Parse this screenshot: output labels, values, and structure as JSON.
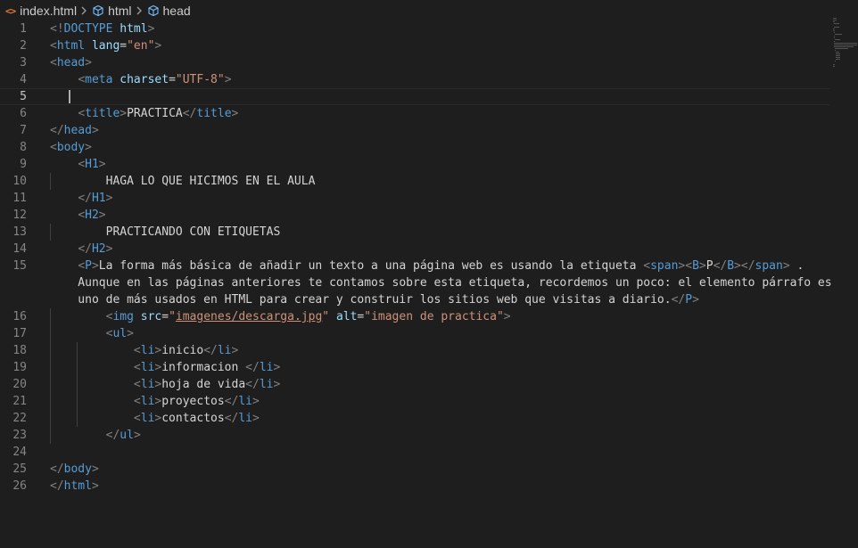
{
  "breadcrumb": {
    "file": "index.html",
    "items": [
      "html",
      "head"
    ]
  },
  "editor": {
    "current_line": 5,
    "lines": [
      {
        "n": "1",
        "tokens": [
          [
            "t",
            "<!"
          ],
          [
            "tn",
            "DOCTYPE"
          ],
          [
            "tx",
            " "
          ],
          [
            "an",
            "html"
          ],
          [
            "t",
            ">"
          ]
        ]
      },
      {
        "n": "2",
        "tokens": [
          [
            "t",
            "<"
          ],
          [
            "tn",
            "html"
          ],
          [
            "tx",
            " "
          ],
          [
            "an",
            "lang"
          ],
          [
            "tx",
            "="
          ],
          [
            "av",
            "\"en\""
          ],
          [
            "t",
            ">"
          ]
        ]
      },
      {
        "n": "3",
        "tokens": [
          [
            "t",
            "<"
          ],
          [
            "tn",
            "head"
          ],
          [
            "t",
            ">"
          ]
        ]
      },
      {
        "n": "4",
        "tokens": [
          [
            "tx",
            "    "
          ],
          [
            "t",
            "<"
          ],
          [
            "tn",
            "meta"
          ],
          [
            "tx",
            " "
          ],
          [
            "an",
            "charset"
          ],
          [
            "tx",
            "="
          ],
          [
            "av",
            "\"UTF-8\""
          ],
          [
            "t",
            ">"
          ]
        ]
      },
      {
        "n": "5",
        "tokens": []
      },
      {
        "n": "6",
        "tokens": [
          [
            "tx",
            "    "
          ],
          [
            "t",
            "<"
          ],
          [
            "tn",
            "title"
          ],
          [
            "t",
            ">"
          ],
          [
            "tx",
            "PRACTICA"
          ],
          [
            "t",
            "</"
          ],
          [
            "tn",
            "title"
          ],
          [
            "t",
            ">"
          ]
        ]
      },
      {
        "n": "7",
        "tokens": [
          [
            "t",
            "</"
          ],
          [
            "tn",
            "head"
          ],
          [
            "t",
            ">"
          ]
        ]
      },
      {
        "n": "8",
        "tokens": [
          [
            "t",
            "<"
          ],
          [
            "tn",
            "body"
          ],
          [
            "t",
            ">"
          ]
        ]
      },
      {
        "n": "9",
        "tokens": [
          [
            "tx",
            "    "
          ],
          [
            "t",
            "<"
          ],
          [
            "tn",
            "H1"
          ],
          [
            "t",
            ">"
          ]
        ]
      },
      {
        "n": "10",
        "tokens": [
          [
            "tx",
            "        HAGA LO QUE HICIMOS EN EL AULA"
          ]
        ]
      },
      {
        "n": "11",
        "tokens": [
          [
            "tx",
            "    "
          ],
          [
            "t",
            "</"
          ],
          [
            "tn",
            "H1"
          ],
          [
            "t",
            ">"
          ]
        ]
      },
      {
        "n": "12",
        "tokens": [
          [
            "tx",
            "    "
          ],
          [
            "t",
            "<"
          ],
          [
            "tn",
            "H2"
          ],
          [
            "t",
            ">"
          ]
        ]
      },
      {
        "n": "13",
        "tokens": [
          [
            "tx",
            "        PRACTICANDO CON ETIQUETAS"
          ]
        ]
      },
      {
        "n": "14",
        "tokens": [
          [
            "tx",
            "    "
          ],
          [
            "t",
            "</"
          ],
          [
            "tn",
            "H2"
          ],
          [
            "t",
            ">"
          ]
        ]
      },
      {
        "n": "15",
        "tokens": [
          [
            "tx",
            "    "
          ],
          [
            "t",
            "<"
          ],
          [
            "tn",
            "P"
          ],
          [
            "t",
            ">"
          ],
          [
            "tx",
            "La forma más básica de añadir un texto a una página web es usando la etiqueta "
          ],
          [
            "t",
            "<"
          ],
          [
            "tn",
            "span"
          ],
          [
            "t",
            "><"
          ],
          [
            "tn",
            "B"
          ],
          [
            "t",
            ">"
          ],
          [
            "tx",
            "P"
          ],
          [
            "t",
            "</"
          ],
          [
            "tn",
            "B"
          ],
          [
            "t",
            "></"
          ],
          [
            "tn",
            "span"
          ],
          [
            "t",
            ">"
          ],
          [
            "tx",
            " ."
          ]
        ]
      },
      {
        "n": "",
        "tokens": [
          [
            "tx",
            "    Aunque en las páginas anteriores te contamos sobre esta etiqueta, recordemos un poco: el elemento párrafo es"
          ]
        ]
      },
      {
        "n": "",
        "tokens": [
          [
            "tx",
            "    uno de más usados en HTML para crear y construir los sitios web que visitas a diario."
          ],
          [
            "t",
            "</"
          ],
          [
            "tn",
            "P"
          ],
          [
            "t",
            ">"
          ]
        ]
      },
      {
        "n": "16",
        "tokens": [
          [
            "tx",
            "        "
          ],
          [
            "t",
            "<"
          ],
          [
            "tn",
            "img"
          ],
          [
            "tx",
            " "
          ],
          [
            "an",
            "src"
          ],
          [
            "tx",
            "="
          ],
          [
            "av",
            "\""
          ],
          [
            "av link",
            "imagenes/descarga.jpg"
          ],
          [
            "av",
            "\""
          ],
          [
            "tx",
            " "
          ],
          [
            "an",
            "alt"
          ],
          [
            "tx",
            "="
          ],
          [
            "av",
            "\"imagen de practica\""
          ],
          [
            "t",
            ">"
          ]
        ]
      },
      {
        "n": "17",
        "tokens": [
          [
            "tx",
            "        "
          ],
          [
            "t",
            "<"
          ],
          [
            "tn",
            "ul"
          ],
          [
            "t",
            ">"
          ]
        ]
      },
      {
        "n": "18",
        "tokens": [
          [
            "tx",
            "            "
          ],
          [
            "t",
            "<"
          ],
          [
            "tn",
            "li"
          ],
          [
            "t",
            ">"
          ],
          [
            "tx",
            "inicio"
          ],
          [
            "t",
            "</"
          ],
          [
            "tn",
            "li"
          ],
          [
            "t",
            ">"
          ]
        ]
      },
      {
        "n": "19",
        "tokens": [
          [
            "tx",
            "            "
          ],
          [
            "t",
            "<"
          ],
          [
            "tn",
            "li"
          ],
          [
            "t",
            ">"
          ],
          [
            "tx",
            "informacion "
          ],
          [
            "t",
            "</"
          ],
          [
            "tn",
            "li"
          ],
          [
            "t",
            ">"
          ]
        ]
      },
      {
        "n": "20",
        "tokens": [
          [
            "tx",
            "            "
          ],
          [
            "t",
            "<"
          ],
          [
            "tn",
            "li"
          ],
          [
            "t",
            ">"
          ],
          [
            "tx",
            "hoja de vida"
          ],
          [
            "t",
            "</"
          ],
          [
            "tn",
            "li"
          ],
          [
            "t",
            ">"
          ]
        ]
      },
      {
        "n": "21",
        "tokens": [
          [
            "tx",
            "            "
          ],
          [
            "t",
            "<"
          ],
          [
            "tn",
            "li"
          ],
          [
            "t",
            ">"
          ],
          [
            "tx",
            "proyectos"
          ],
          [
            "t",
            "</"
          ],
          [
            "tn",
            "li"
          ],
          [
            "t",
            ">"
          ]
        ]
      },
      {
        "n": "22",
        "tokens": [
          [
            "tx",
            "            "
          ],
          [
            "t",
            "<"
          ],
          [
            "tn",
            "li"
          ],
          [
            "t",
            ">"
          ],
          [
            "tx",
            "contactos"
          ],
          [
            "t",
            "</"
          ],
          [
            "tn",
            "li"
          ],
          [
            "t",
            ">"
          ]
        ]
      },
      {
        "n": "23",
        "tokens": [
          [
            "tx",
            "        "
          ],
          [
            "t",
            "</"
          ],
          [
            "tn",
            "ul"
          ],
          [
            "t",
            ">"
          ]
        ]
      },
      {
        "n": "24",
        "tokens": []
      },
      {
        "n": "25",
        "tokens": [
          [
            "t",
            "</"
          ],
          [
            "tn",
            "body"
          ],
          [
            "t",
            ">"
          ]
        ]
      },
      {
        "n": "26",
        "tokens": [
          [
            "t",
            "</"
          ],
          [
            "tn",
            "html"
          ],
          [
            "t",
            ">"
          ]
        ]
      }
    ]
  },
  "colors": {
    "background": "#1e1e1e",
    "tag_bracket": "#808080",
    "tag_name": "#569cd6",
    "attribute_name": "#9cdcfe",
    "attribute_value": "#ce9178",
    "text": "#d4d4d4",
    "line_number": "#858585",
    "html_file_icon": "#e37933"
  }
}
